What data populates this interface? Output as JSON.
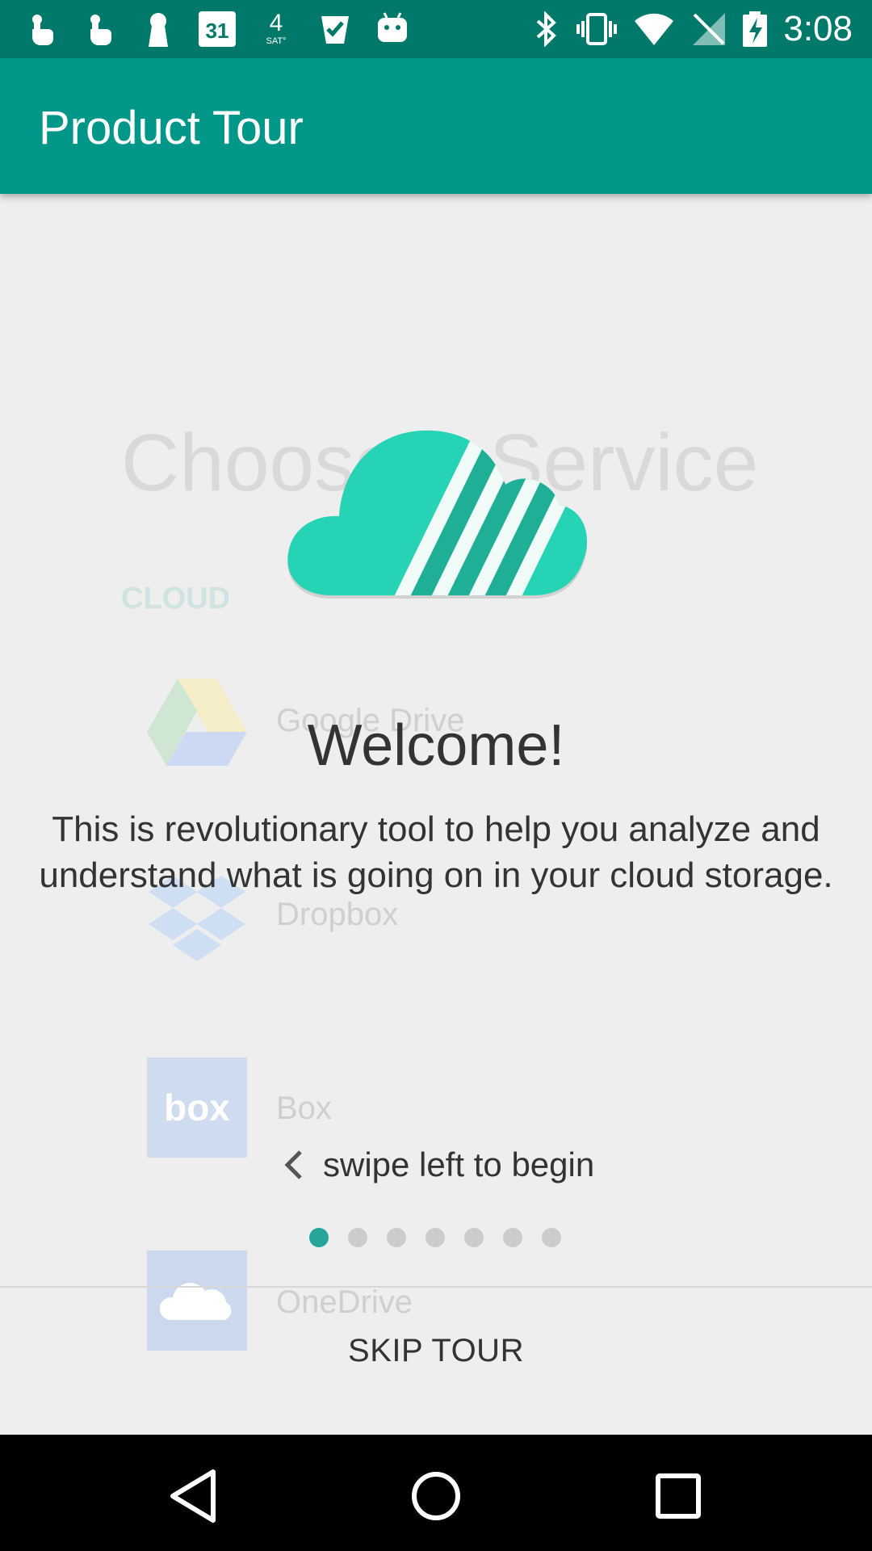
{
  "status_bar": {
    "time": "3:08",
    "left_icons": [
      "touch-icon",
      "touch-icon",
      "keyhole-icon",
      "calendar-icon",
      "weather-icon",
      "check-icon",
      "android-icon"
    ],
    "calendar_day": "31",
    "weather_temp": "4",
    "weather_label": "SAT°",
    "right_icons": [
      "bluetooth-icon",
      "vibrate-icon",
      "wifi-icon",
      "no-signal-icon",
      "battery-charging-icon"
    ]
  },
  "app_bar": {
    "title": "Product Tour"
  },
  "background_page": {
    "heading": "Choose a Service",
    "section": "CLOUD",
    "services": [
      {
        "label": "Google Drive",
        "icon": "google-drive-icon"
      },
      {
        "label": "Dropbox",
        "icon": "dropbox-icon"
      },
      {
        "label": "Box",
        "icon": "box-icon"
      },
      {
        "label": "OneDrive",
        "icon": "onedrive-icon"
      }
    ]
  },
  "tour": {
    "logo": "cloud-logo-icon",
    "title": "Welcome!",
    "body": "This is revolutionary tool to help you analyze and understand what is going on in your cloud storage.",
    "swipe_hint": "swipe left to begin",
    "pages_total": 7,
    "current_page": 1,
    "skip_label": "SKIP TOUR"
  },
  "colors": {
    "status_bar": "#00796b",
    "app_bar": "#009688",
    "accent": "#26a69a",
    "logo": "#26d3b5"
  },
  "nav_bar": {
    "buttons": [
      "back-icon",
      "home-icon",
      "recents-icon"
    ]
  }
}
